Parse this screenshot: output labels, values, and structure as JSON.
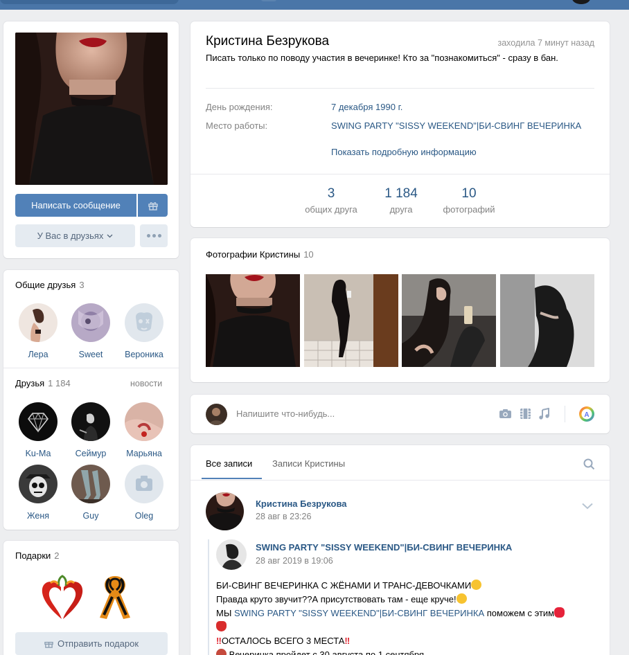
{
  "profile": {
    "name": "Кристина Безрукова",
    "online": "заходила 7 минут назад",
    "status": "Писать только по поводу участия в вечеринке! Кто за \"познакомиться\" - сразу в бан.",
    "info": [
      {
        "label": "День рождения:",
        "value": "7 декабря 1990 г."
      },
      {
        "label": "Место работы:",
        "value": "SWING PARTY \"SISSY WEEKEND\"|БИ-СВИНГ ВЕЧЕРИНКА"
      }
    ],
    "show_more": "Показать подробную информацию",
    "counters": [
      {
        "num": "3",
        "label": "общих друга"
      },
      {
        "num": "1 184",
        "label": "друга"
      },
      {
        "num": "10",
        "label": "фотографий"
      }
    ]
  },
  "actions": {
    "message": "Написать сообщение",
    "friend_status": "У Вас в друзьях"
  },
  "mutual": {
    "title": "Общие друзья",
    "count": "3",
    "items": [
      "Лера",
      "Sweet",
      "Вероника"
    ]
  },
  "friends": {
    "title": "Друзья",
    "count": "1 184",
    "news": "новости",
    "items": [
      "Ku-Ma",
      "Сеймур",
      "Марьяна",
      "Женя",
      "Guy",
      "Oleg"
    ]
  },
  "gifts": {
    "title": "Подарки",
    "count": "2",
    "send": "Отправить подарок"
  },
  "photos": {
    "title": "Фотографии Кристины",
    "count": "10"
  },
  "composer": {
    "placeholder": "Напишите что-нибудь..."
  },
  "wall": {
    "tabs": [
      "Все записи",
      "Записи Кристины"
    ],
    "post": {
      "author": "Кристина Безрукова",
      "date": "28 авг в 23:26",
      "repost_author": "SWING PARTY \"SISSY WEEKEND\"|БИ-СВИНГ ВЕЧЕРИНКА",
      "repost_date": "28 авг 2019 в 19:06",
      "line1": "БИ-СВИНГ ВЕЧЕРИНКА С ЖЁНАМИ И ТРАНС-ДЕВОЧКАМИ",
      "line2": "Правда круто звучит??А присутствовать там - еще круче!",
      "line3_a": "МЫ ",
      "line3_link": "SWING PARTY \"SISSY WEEKEND\"|БИ-СВИНГ ВЕЧЕРИНКА",
      "line3_b": " поможем с этим",
      "line4": "ОСТАЛОСЬ ВСЕГО 3 МЕСТА",
      "line5": "Вечеринка пройдет с 30 августа по 1 сентября"
    }
  },
  "colors": {
    "accent": "#5181b8",
    "link": "#2a5885",
    "background": "#edeef0"
  }
}
